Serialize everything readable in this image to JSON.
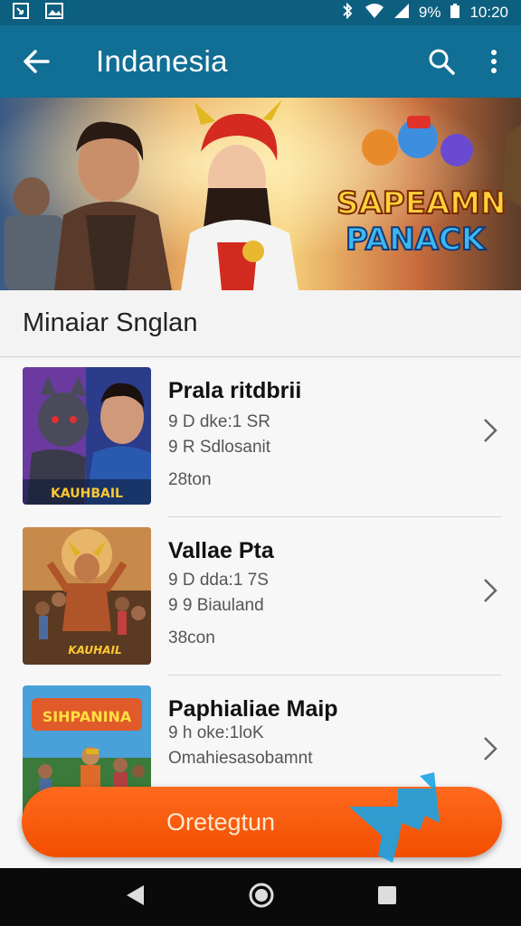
{
  "status_bar": {
    "battery": "9%",
    "time": "10:20"
  },
  "app_bar": {
    "title": "Indanesia"
  },
  "banner": {
    "logo_line1": "SAPEAMN",
    "logo_line2": "PANACK"
  },
  "section": {
    "title": "Minaiar Snglan"
  },
  "items": [
    {
      "title": "Prala ritdbrii",
      "line1": "9 D dke:1 SR",
      "line2": "9 R Sdlosanit",
      "line3": "28ton",
      "thumb_label": "KAUHBAIL"
    },
    {
      "title": "Vallae Pta",
      "line1": "9 D dda:1 7S",
      "line2": "9 9 Biauland",
      "line3": "38con",
      "thumb_label": "KAUHAIL"
    },
    {
      "title": "Paphialiae Maip",
      "line1": "9 h oke:1loK",
      "line2": "Omahiesasobamnt",
      "line3": "",
      "thumb_label": "SIHPANINA"
    }
  ],
  "cta": {
    "label": "Oretegtun"
  },
  "colors": {
    "status_bar": "#0d5f7f",
    "app_bar": "#116e94",
    "cta": "#f45400",
    "cursor": "#1aa3e6"
  },
  "icons": [
    "back-arrow-icon",
    "search-icon",
    "more-vert-icon",
    "chevron-right-icon",
    "nav-back-icon",
    "nav-home-icon",
    "nav-recents-icon"
  ]
}
